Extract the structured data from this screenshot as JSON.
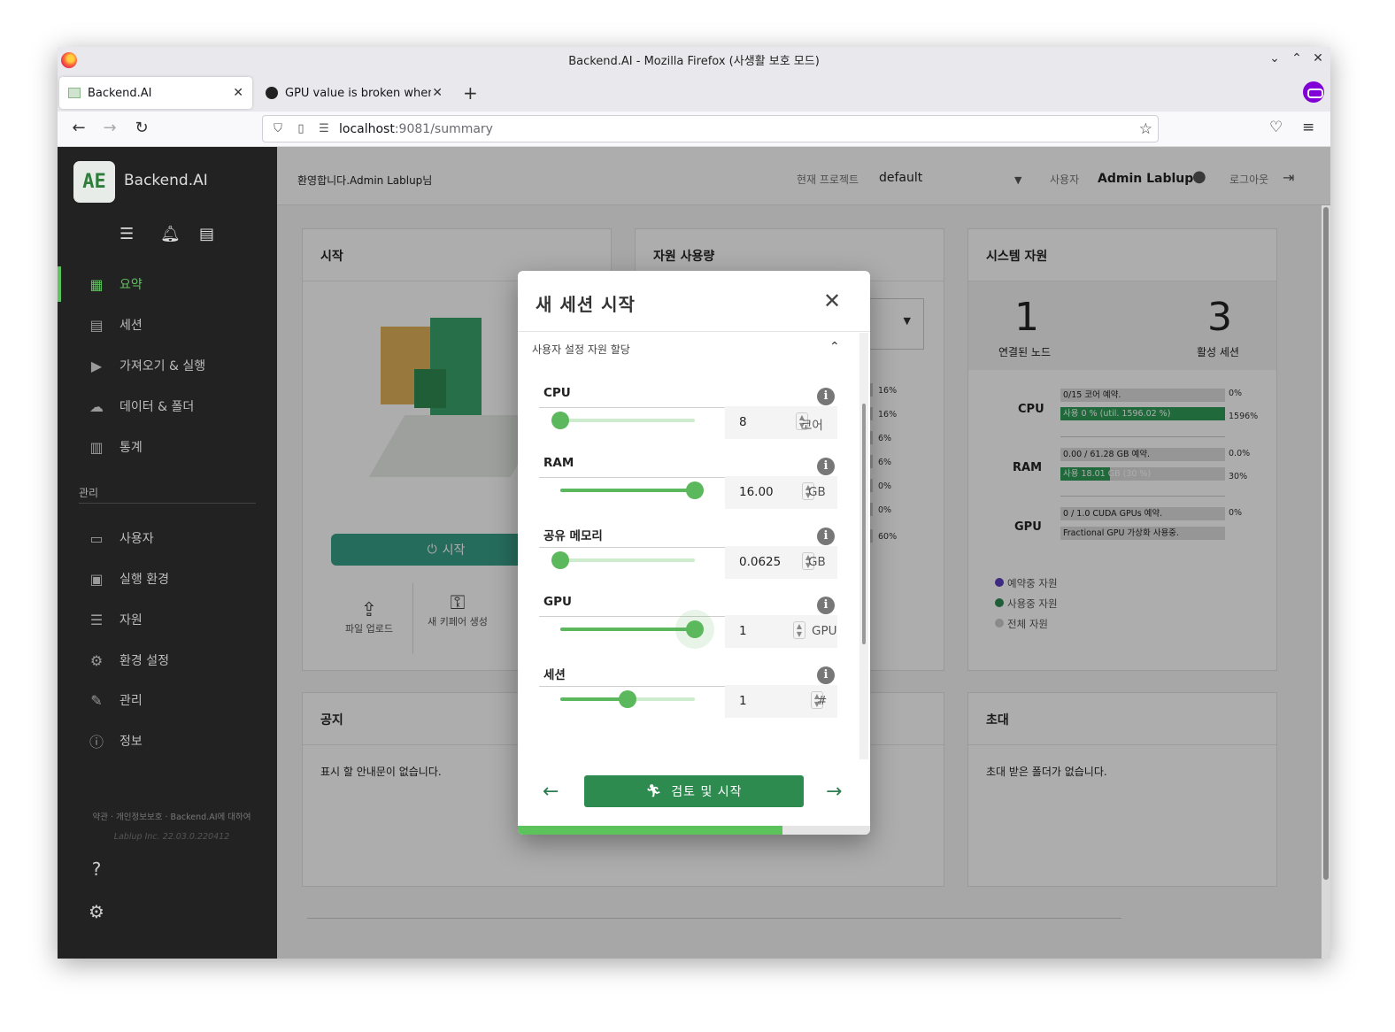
{
  "window": {
    "title": "Backend.AI - Mozilla Firefox (사생활 보호 모드)"
  },
  "tabs": [
    {
      "label": "Backend.AI"
    },
    {
      "label": "GPU value is broken when"
    }
  ],
  "url": {
    "host": "localhost",
    "path": ":9081/summary"
  },
  "sidebar": {
    "brand": "Backend.AI",
    "logo_text": "AE",
    "items": [
      {
        "label": "요약",
        "icon": "grid-icon"
      },
      {
        "label": "세션",
        "icon": "list-icon"
      },
      {
        "label": "가져오기 & 실행",
        "icon": "play-icon"
      },
      {
        "label": "데이터 & 폴더",
        "icon": "cloud-upload-icon"
      },
      {
        "label": "통계",
        "icon": "bar-chart-icon"
      }
    ],
    "admin_section": "관리",
    "admin_items": [
      {
        "label": "사용자",
        "icon": "id-card-icon"
      },
      {
        "label": "실행 환경",
        "icon": "chip-icon"
      },
      {
        "label": "자원",
        "icon": "server-icon"
      },
      {
        "label": "환경 설정",
        "icon": "gear-icon"
      },
      {
        "label": "관리",
        "icon": "wrench-icon"
      },
      {
        "label": "정보",
        "icon": "info-icon"
      }
    ],
    "footer_links": "약관 · 개인정보보호 · Backend.AI에 대하여",
    "footer_version": "Lablup Inc. 22.03.0.220412"
  },
  "header": {
    "welcome": "환영합니다.Admin Lablup님",
    "project_label": "현재 프로젝트",
    "project_value": "default",
    "user_label": "사용자",
    "user_name": "Admin Lablup",
    "logout_label": "로그아웃"
  },
  "cards": {
    "start": {
      "title": "시작",
      "button": "시작",
      "upload": "파일 업로드",
      "keypair": "새 키페어 생성"
    },
    "usage": {
      "title": "자원 사용량",
      "percents": [
        "16%",
        "16%",
        "6%",
        "6%",
        "0%",
        "0%",
        "60%"
      ]
    },
    "system": {
      "title": "시스템 자원",
      "nodes_value": "1",
      "nodes_label": "연결된 노드",
      "sessions_value": "3",
      "sessions_label": "활성 세션",
      "cpu": {
        "label": "CPU",
        "reserved": "0/15 코어 예약.",
        "used": "사용 0 % (util. 1596.02 %)",
        "pct_reserved": "0%",
        "pct_used": "1596%",
        "used_fill": 1.0
      },
      "ram": {
        "label": "RAM",
        "reserved": "0.00 / 61.28 GB 예약.",
        "used": "사용 18.01 GB (30 %)",
        "pct_reserved": "0.0%",
        "pct_used": "30%",
        "used_fill": 0.3
      },
      "gpu": {
        "label": "GPU",
        "reserved": "0 / 1.0 CUDA GPUs 예약.",
        "note": "Fractional GPU 가상화 사용중.",
        "pct_reserved": "0%"
      },
      "legend": [
        "예약중 자원",
        "사용중 자원",
        "전체 자원"
      ],
      "legend_colors": [
        "#5b3fbf",
        "#2e8b50",
        "#cccccc"
      ]
    },
    "notice": {
      "title": "공지",
      "body": "표시 할 안내문이 없습니다."
    },
    "invite": {
      "title": "초대",
      "body": "초대 받은 폴더가 없습니다."
    }
  },
  "modal": {
    "title": "새 세션 시작",
    "section": "사용자 설정 자원 할당",
    "resources": [
      {
        "label": "CPU",
        "value": "8",
        "unit": "코어",
        "slider": 0.0
      },
      {
        "label": "RAM",
        "value": "16.00",
        "unit": "GB",
        "slider": 1.0
      },
      {
        "label": "공유 메모리",
        "value": "0.0625",
        "unit": "GB",
        "slider": 0.0
      },
      {
        "label": "GPU",
        "value": "1",
        "unit": "GPU",
        "slider": 1.0
      },
      {
        "label": "세션",
        "value": "1",
        "unit": "#",
        "slider": 0.5
      }
    ],
    "launch_label": "검토 및 시작",
    "progress": 0.75
  }
}
